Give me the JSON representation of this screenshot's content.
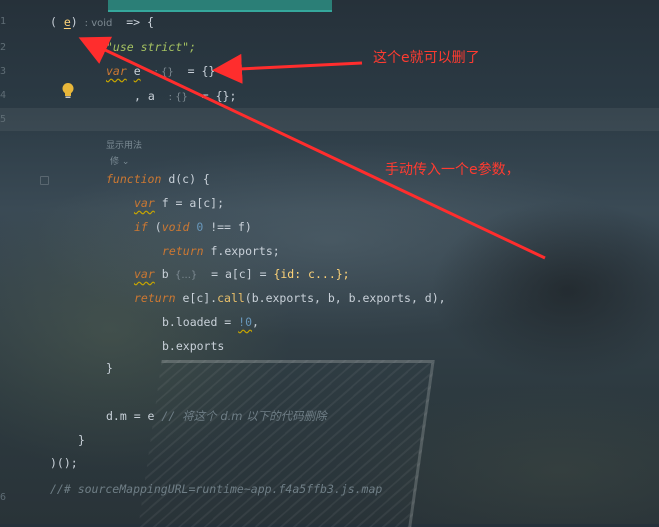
{
  "code": {
    "line1": {
      "open": "( ",
      "param": "e",
      "close": ")",
      "hint": ": void",
      "arrow": "  => {"
    },
    "line2": {
      "text": "\"use strict\";"
    },
    "line3": {
      "kw": "var",
      "name": "e",
      "hint": ": {}",
      "rest": "  = {}"
    },
    "line4": {
      "prefix": ", a",
      "hint": ": {}",
      "rest": "  = {};"
    },
    "usage_hint": "显示用法",
    "usage_ctrl": "修 ⌄",
    "line5": {
      "kw": "function",
      "rest": " d(c) {"
    },
    "line6": {
      "kw": "var",
      "rest": " f = a[c];"
    },
    "line7": {
      "kw": "if",
      "paren": " (",
      "kw2": "void",
      "num": " 0",
      "rest": " !== f)"
    },
    "line8": {
      "kw": "return",
      "rest": " f.exports;"
    },
    "line9": {
      "kw": "var",
      "name": " b",
      "hint": "  {...}",
      "rest": "  = a[c] = ",
      "obj": "{id: c...};"
    },
    "line10": {
      "kw": "return",
      "pre": " e[c].",
      "fn": "call",
      "rest": "(b.exports, b, b.exports, d),"
    },
    "line11": {
      "pre": "b.loaded = ",
      "num": "!0",
      "rest": ","
    },
    "line12": {
      "text": "b.exports"
    },
    "line13": {
      "text": "}"
    },
    "line14": {
      "pre": "d.m = e ",
      "comment": "// ",
      "comment_cn": "将这个 d.m 以下的代码删除"
    },
    "line15": {
      "text": "}"
    },
    "line16": {
      "text": ")();"
    },
    "line17": {
      "text": "//# sourceMappingURL=runtime~app.f4a5ffb3.js.map"
    }
  },
  "line_numbers": [
    "1",
    "2",
    "3",
    "4",
    "5",
    "6"
  ],
  "annotations": {
    "note1": "这个e就可以删了",
    "note2": "手动传入一个e参数，"
  },
  "colors": {
    "annotation": "#ff3b30",
    "keyword": "#cc7832",
    "string": "#a5c261",
    "tab_accent": "#35a79c"
  }
}
